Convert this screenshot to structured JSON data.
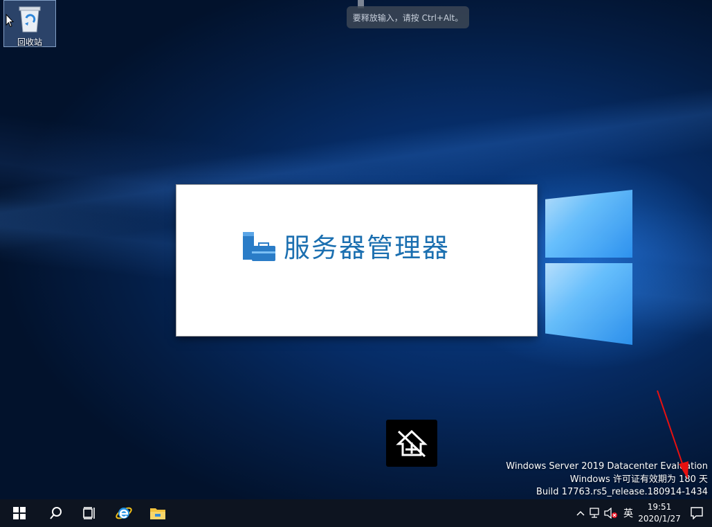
{
  "desktop": {
    "icons": [
      {
        "label": "回收站",
        "icon": "recycle-bin-icon"
      }
    ]
  },
  "toast": {
    "text": "要释放输入，请按 Ctrl+Alt。"
  },
  "splash": {
    "title": "服务器管理器",
    "icon": "server-manager-icon",
    "title_color": "#1b6fb0"
  },
  "watermark": {
    "line1": "Windows Server 2019 Datacenter Evaluation",
    "line2": "Windows 许可证有效期为 180 天",
    "line3": "Build 17763.rs5_release.180914-1434"
  },
  "taskbar": {
    "pinned": [
      {
        "name": "start-icon"
      },
      {
        "name": "search-icon"
      },
      {
        "name": "task-view-icon"
      },
      {
        "name": "internet-explorer-icon"
      },
      {
        "name": "file-explorer-icon"
      }
    ],
    "tray": {
      "ime_label": "英",
      "time": "19:51",
      "date": "2020/1/27"
    }
  },
  "colors": {
    "taskbar": "#0d1420",
    "accent_blue": "#1b6fb0"
  }
}
